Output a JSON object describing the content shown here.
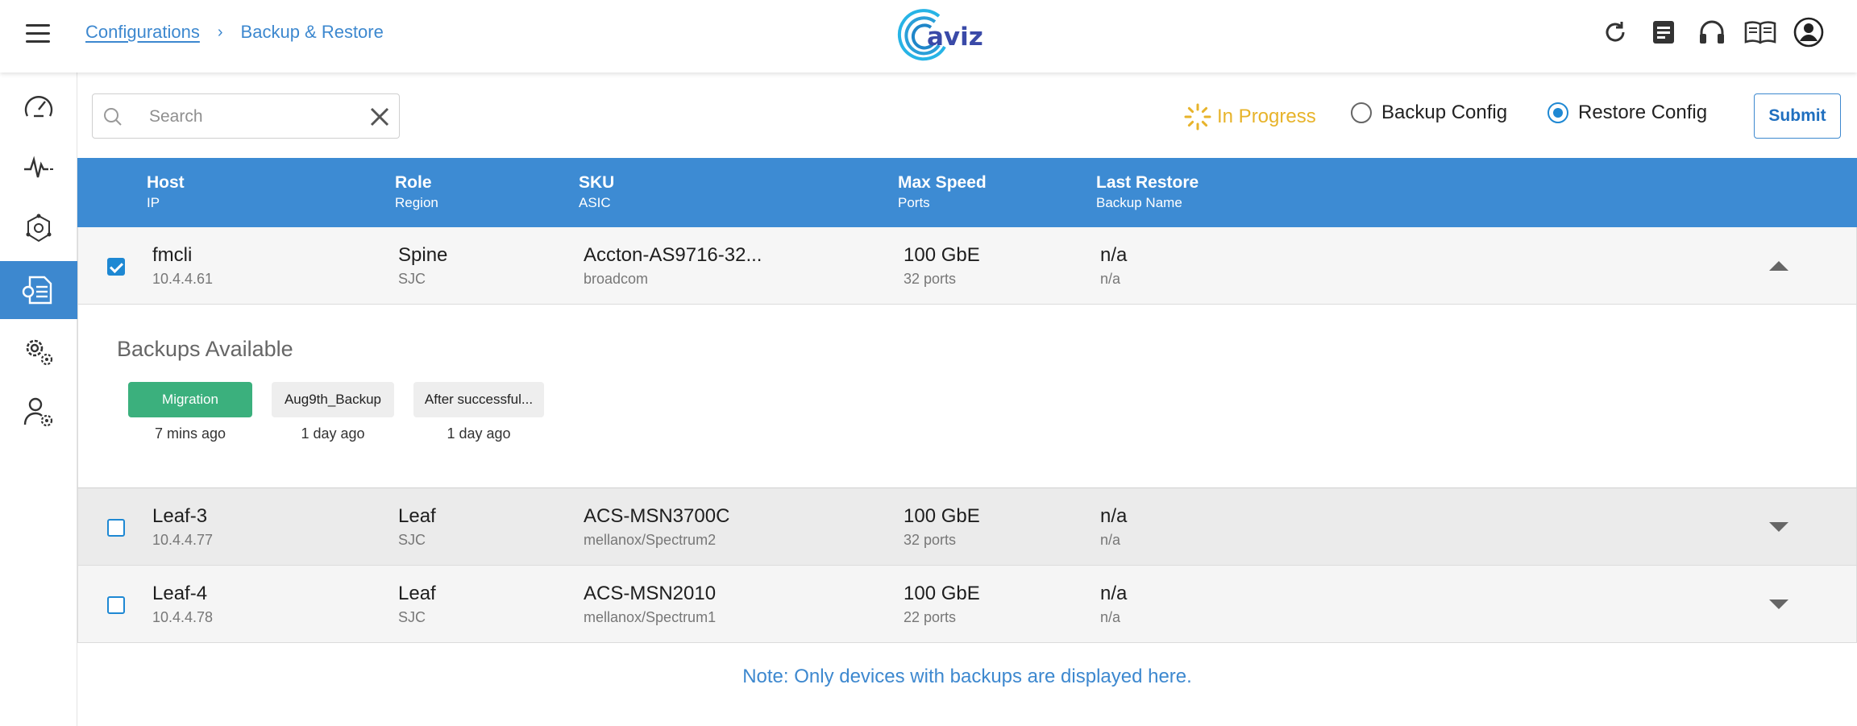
{
  "header": {
    "breadcrumb": {
      "parent": "Configurations",
      "separator": "›",
      "current": "Backup & Restore"
    },
    "logo_text": "aviz",
    "icons": [
      "refresh-icon",
      "notes-icon",
      "headset-icon",
      "book-icon",
      "account-icon"
    ]
  },
  "sidebar": {
    "items": [
      {
        "icon": "dashboard-icon",
        "active": false
      },
      {
        "icon": "pulse-icon",
        "active": false
      },
      {
        "icon": "topology-icon",
        "active": false
      },
      {
        "icon": "config-file-icon",
        "active": true
      },
      {
        "icon": "settings-gears-icon",
        "active": false
      },
      {
        "icon": "user-settings-icon",
        "active": false
      }
    ]
  },
  "toolbar": {
    "search_placeholder": "Search",
    "search_value": "",
    "status_label": "In Progress",
    "backup_label": "Backup Config",
    "restore_label": "Restore Config",
    "selected_mode": "restore",
    "submit_label": "Submit",
    "status_color": "#e7b32a"
  },
  "table": {
    "columns": [
      {
        "primary": "Host",
        "secondary": "IP"
      },
      {
        "primary": "Role",
        "secondary": "Region"
      },
      {
        "primary": "SKU",
        "secondary": "ASIC"
      },
      {
        "primary": "Max Speed",
        "secondary": "Ports"
      },
      {
        "primary": "Last Restore",
        "secondary": "Backup Name"
      }
    ],
    "rows": [
      {
        "host": "fmcli",
        "ip": "10.4.4.61",
        "role": "Spine",
        "region": "SJC",
        "sku": "Accton-AS9716-32...",
        "asic": "broadcom",
        "speed": "100 GbE",
        "ports": "32 ports",
        "last_restore": "n/a",
        "backup_name": "n/a",
        "checked": true,
        "expanded": true
      },
      {
        "host": "Leaf-3",
        "ip": "10.4.4.77",
        "role": "Leaf",
        "region": "SJC",
        "sku": "ACS-MSN3700C",
        "asic": "mellanox/Spectrum2",
        "speed": "100 GbE",
        "ports": "32 ports",
        "last_restore": "n/a",
        "backup_name": "n/a",
        "checked": false,
        "expanded": false
      },
      {
        "host": "Leaf-4",
        "ip": "10.4.4.78",
        "role": "Leaf",
        "region": "SJC",
        "sku": "ACS-MSN2010",
        "asic": "mellanox/Spectrum1",
        "speed": "100 GbE",
        "ports": "22 ports",
        "last_restore": "n/a",
        "backup_name": "n/a",
        "checked": false,
        "expanded": false
      }
    ],
    "header_color": "#3d8bd3"
  },
  "backups": {
    "title": "Backups Available",
    "items": [
      {
        "name": "Migration",
        "ago": "7 mins ago",
        "selected": true
      },
      {
        "name": "Aug9th_Backup",
        "ago": "1 day ago",
        "selected": false
      },
      {
        "name": "After successful...",
        "ago": "1 day ago",
        "selected": false
      }
    ],
    "selected_color": "#3bb07d"
  },
  "note": "Note: Only devices with backups are displayed here."
}
